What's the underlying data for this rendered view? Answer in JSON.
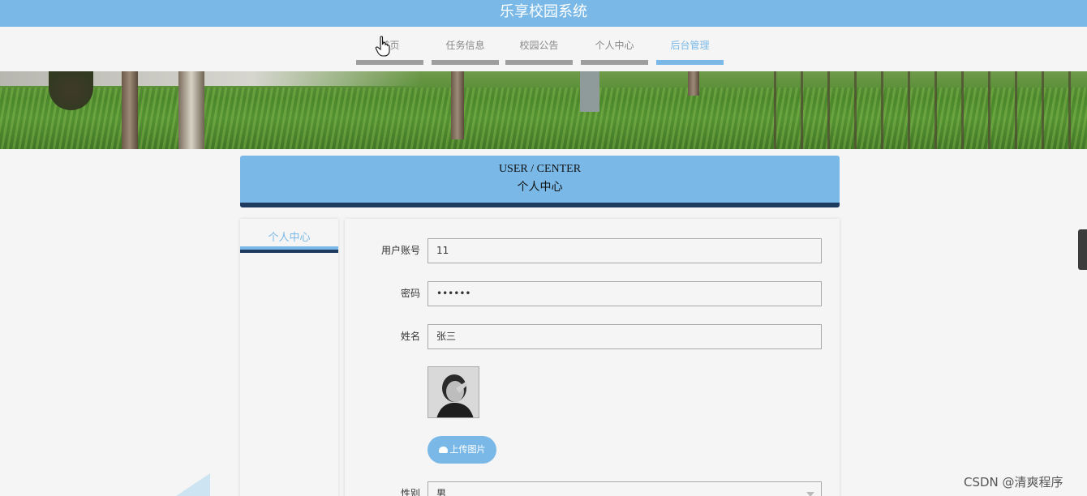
{
  "app": {
    "title": "乐享校园系统"
  },
  "nav": [
    {
      "label": "首页",
      "active": false
    },
    {
      "label": "任务信息",
      "active": false
    },
    {
      "label": "校园公告",
      "active": false
    },
    {
      "label": "个人中心",
      "active": false
    },
    {
      "label": "后台管理",
      "active": true
    }
  ],
  "page_header": {
    "title_en": "USER / CENTER",
    "title_zh": "个人中心"
  },
  "sidebar": {
    "items": [
      {
        "label": "个人中心",
        "active": true
      }
    ]
  },
  "form": {
    "username": {
      "label": "用户账号",
      "value": "11"
    },
    "password": {
      "label": "密码",
      "value": "••••••"
    },
    "name": {
      "label": "姓名",
      "value": "张三"
    },
    "upload_button": "上传图片",
    "gender": {
      "label": "性别",
      "value": "男"
    }
  },
  "watermark": "CSDN @清爽程序",
  "colors": {
    "accent": "#7ab9e7",
    "dark_navy": "#1e3a5f",
    "nav_bar_inactive": "#9e9e9e"
  }
}
